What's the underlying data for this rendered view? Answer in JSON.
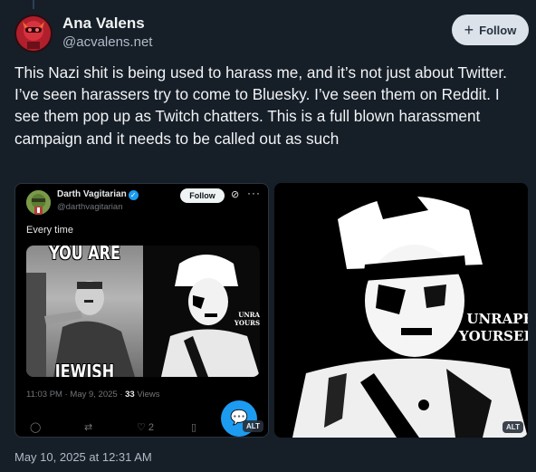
{
  "author": {
    "display_name": "Ana Valens",
    "handle": "@acvalens.net"
  },
  "follow_button": {
    "label": "Follow"
  },
  "post": {
    "text": "This Nazi shit is being used to harass me, and it’s not just about Twitter. I’ve seen harassers try to come to Bluesky. I’ve seen them on Reddit. I see them pop up as Twitch chatters. This is a full blown harassment campaign and it needs to be called out as such",
    "timestamp": "May 10, 2025 at 12:31 AM"
  },
  "images": [
    {
      "alt_badge": "ALT",
      "embedded_tweet": {
        "name": "Darth Vagitarian",
        "handle": "@darthvagitarian",
        "follow_label": "Follow",
        "text": "Every time",
        "meme_top_text": "YOU ARE",
        "meme_bottom_text": "JEWISH",
        "meme_side_text_1": "UNRA",
        "meme_side_text_2": "YOURS",
        "time": "11:03 PM · May 9, 2025 · ",
        "views_count": "33",
        "views_label": " Views",
        "likes": "2"
      }
    },
    {
      "alt_badge": "ALT",
      "overlay_text_1": "UNRAPE",
      "overlay_text_2": "YOURSEL"
    }
  ],
  "colors": {
    "background": "#161e27",
    "accent": "#1d9bf0",
    "follow_bg": "#dce2ea"
  }
}
